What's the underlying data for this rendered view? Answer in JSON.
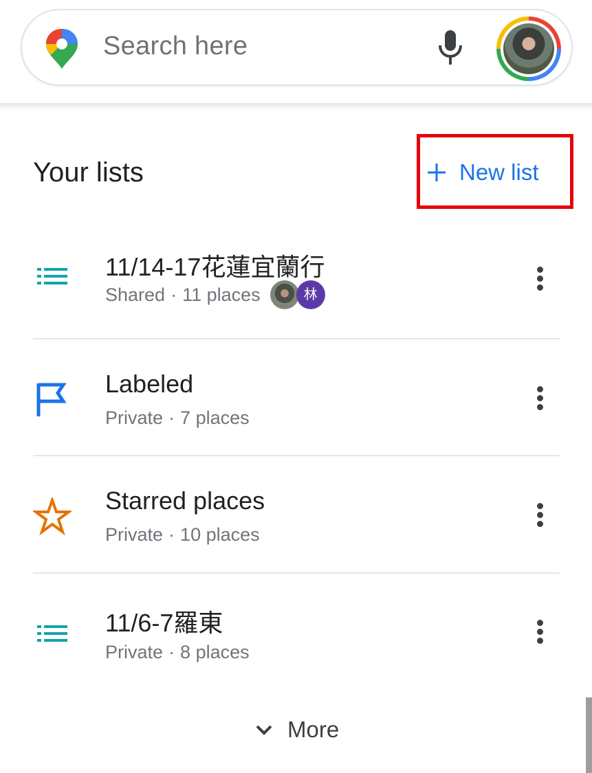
{
  "search": {
    "placeholder": "Search here",
    "logo_icon": "google-maps-pin-icon",
    "mic_icon": "microphone-icon",
    "avatar_icon": "account-avatar"
  },
  "lists_section": {
    "title": "Your lists",
    "new_list_label": "New list",
    "new_list_icon": "plus-icon",
    "highlight_color": "#e8000b",
    "accent_color": "#1a73e8"
  },
  "lists": [
    {
      "title": "11/14-17花蓮宜蘭行",
      "visibility": "Shared",
      "count": "11 places",
      "icon": "list-icon",
      "icon_color": "#12a4a8",
      "shared_initial": "林"
    },
    {
      "title": "Labeled",
      "visibility": "Private",
      "count": "7 places",
      "icon": "flag-icon",
      "icon_color": "#1a73e8"
    },
    {
      "title": "Starred places",
      "visibility": "Private",
      "count": "10 places",
      "icon": "star-icon",
      "icon_color": "#e37400"
    },
    {
      "title": "11/6-7羅東",
      "visibility": "Private",
      "count": "8 places",
      "icon": "list-icon",
      "icon_color": "#12a4a8"
    }
  ],
  "more": {
    "label": "More",
    "icon": "chevron-down-icon"
  },
  "sep": "·"
}
